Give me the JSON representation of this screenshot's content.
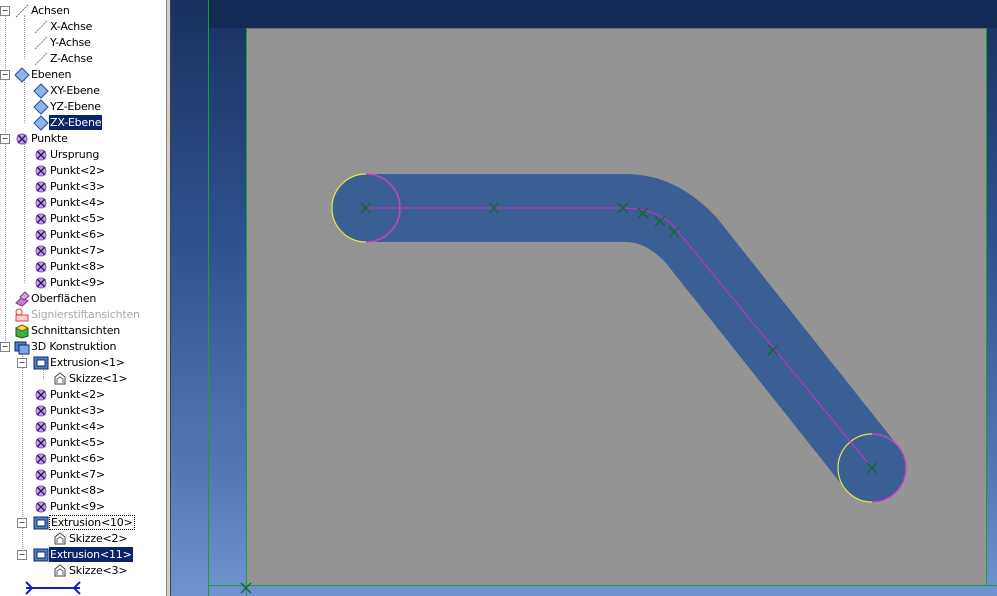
{
  "tree": {
    "items": [
      {
        "label": "Achsen",
        "level": 0,
        "expander": "−",
        "icon": "axes-icon",
        "state": "normal"
      },
      {
        "label": "X-Achse",
        "level": 1,
        "expander": "",
        "icon": "axis-icon",
        "state": "normal"
      },
      {
        "label": "Y-Achse",
        "level": 1,
        "expander": "",
        "icon": "axis-icon",
        "state": "normal"
      },
      {
        "label": "Z-Achse",
        "level": 1,
        "expander": "",
        "icon": "axis-icon",
        "state": "normal"
      },
      {
        "label": "Ebenen",
        "level": 0,
        "expander": "−",
        "icon": "plane-icon",
        "state": "normal"
      },
      {
        "label": "XY-Ebene",
        "level": 1,
        "expander": "",
        "icon": "plane-icon",
        "state": "normal"
      },
      {
        "label": "YZ-Ebene",
        "level": 1,
        "expander": "",
        "icon": "plane-icon",
        "state": "normal"
      },
      {
        "label": "ZX-Ebene",
        "level": 1,
        "expander": "",
        "icon": "plane-icon",
        "state": "selected"
      },
      {
        "label": "Punkte",
        "level": 0,
        "expander": "−",
        "icon": "point-icon",
        "state": "normal"
      },
      {
        "label": "Ursprung",
        "level": 1,
        "expander": "",
        "icon": "point-icon",
        "state": "normal"
      },
      {
        "label": "Punkt<2>",
        "level": 1,
        "expander": "",
        "icon": "point-icon",
        "state": "normal"
      },
      {
        "label": "Punkt<3>",
        "level": 1,
        "expander": "",
        "icon": "point-icon",
        "state": "normal"
      },
      {
        "label": "Punkt<4>",
        "level": 1,
        "expander": "",
        "icon": "point-icon",
        "state": "normal"
      },
      {
        "label": "Punkt<5>",
        "level": 1,
        "expander": "",
        "icon": "point-icon",
        "state": "normal"
      },
      {
        "label": "Punkt<6>",
        "level": 1,
        "expander": "",
        "icon": "point-icon",
        "state": "normal"
      },
      {
        "label": "Punkt<7>",
        "level": 1,
        "expander": "",
        "icon": "point-icon",
        "state": "normal"
      },
      {
        "label": "Punkt<8>",
        "level": 1,
        "expander": "",
        "icon": "point-icon",
        "state": "normal"
      },
      {
        "label": "Punkt<9>",
        "level": 1,
        "expander": "",
        "icon": "point-icon",
        "state": "normal"
      },
      {
        "label": "Oberflächen",
        "level": 0,
        "expander": "",
        "icon": "surfaces-icon",
        "state": "normal"
      },
      {
        "label": "Signierstiftansichten",
        "level": 0,
        "expander": "",
        "icon": "markup-icon",
        "state": "disabled"
      },
      {
        "label": "Schnittansichten",
        "level": 0,
        "expander": "",
        "icon": "section-view-icon",
        "state": "normal"
      },
      {
        "label": "3D Konstruktion",
        "level": 0,
        "expander": "−",
        "icon": "construction-3d-icon",
        "state": "normal"
      },
      {
        "label": "Extrusion<1>",
        "level": 1,
        "expander": "−",
        "icon": "extrusion-icon",
        "state": "normal"
      },
      {
        "label": "Skizze<1>",
        "level": 2,
        "expander": "",
        "icon": "sketch-icon",
        "state": "normal"
      },
      {
        "label": "Punkt<2>",
        "level": 1,
        "expander": "",
        "icon": "point-icon",
        "state": "normal"
      },
      {
        "label": "Punkt<3>",
        "level": 1,
        "expander": "",
        "icon": "point-icon",
        "state": "normal"
      },
      {
        "label": "Punkt<4>",
        "level": 1,
        "expander": "",
        "icon": "point-icon",
        "state": "normal"
      },
      {
        "label": "Punkt<5>",
        "level": 1,
        "expander": "",
        "icon": "point-icon",
        "state": "normal"
      },
      {
        "label": "Punkt<6>",
        "level": 1,
        "expander": "",
        "icon": "point-icon",
        "state": "normal"
      },
      {
        "label": "Punkt<7>",
        "level": 1,
        "expander": "",
        "icon": "point-icon",
        "state": "normal"
      },
      {
        "label": "Punkt<8>",
        "level": 1,
        "expander": "",
        "icon": "point-icon",
        "state": "normal"
      },
      {
        "label": "Punkt<9>",
        "level": 1,
        "expander": "",
        "icon": "point-icon",
        "state": "normal"
      },
      {
        "label": "Extrusion<10>",
        "level": 1,
        "expander": "−",
        "icon": "extrusion-icon",
        "state": "focused"
      },
      {
        "label": "Skizze<2>",
        "level": 2,
        "expander": "",
        "icon": "sketch-icon",
        "state": "normal"
      },
      {
        "label": "Extrusion<11>",
        "level": 1,
        "expander": "−",
        "icon": "extrusion-icon",
        "state": "selected"
      },
      {
        "label": "Skizze<3>",
        "level": 2,
        "expander": "",
        "icon": "sketch-icon",
        "state": "normal"
      }
    ]
  },
  "colors": {
    "viewport_top": "#1a3160",
    "viewport_bottom": "#6f93cf",
    "plane_fill": "#949494",
    "slot_fill": "#3a5f94",
    "sketch_path": "#d52ad5",
    "end_arc": "#e6e640",
    "point_marker": "#0e6a2a",
    "frame_line": "#17a03a",
    "selection": "#0a246a"
  },
  "icons": {
    "expander": "minus-box",
    "bottom_tool": "dimension-tool-icon"
  }
}
